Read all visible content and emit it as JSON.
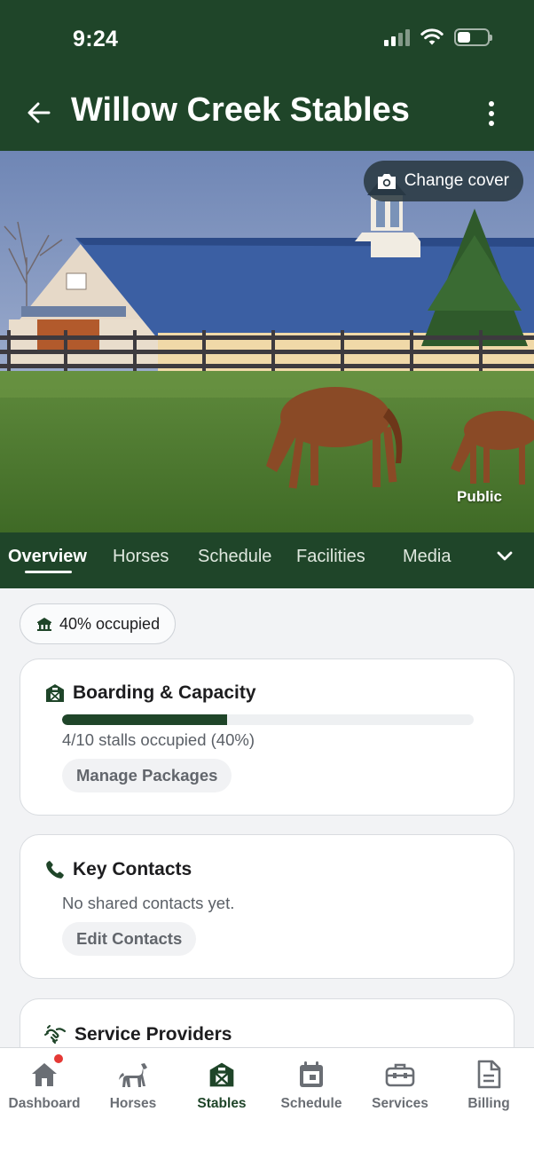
{
  "status_bar": {
    "time": "9:24"
  },
  "header": {
    "title": "Willow Creek Stables"
  },
  "cover": {
    "change_cover_label": "Change cover",
    "visibility_label": "Public"
  },
  "tabs": [
    {
      "label": "Overview",
      "active": true
    },
    {
      "label": "Horses"
    },
    {
      "label": "Schedule"
    },
    {
      "label": "Facilities"
    },
    {
      "label": "Media"
    }
  ],
  "occupancy_pill": {
    "label": "40% occupied"
  },
  "boarding": {
    "title": "Boarding & Capacity",
    "progress_fraction": 0.4,
    "summary": "4/10 stalls occupied (40%)",
    "button": "Manage Packages"
  },
  "contacts": {
    "title": "Key Contacts",
    "empty_text": "No shared contacts yet.",
    "button": "Edit Contacts"
  },
  "providers": {
    "title": "Service Providers"
  },
  "bottom_nav": [
    {
      "label": "Dashboard",
      "icon": "home-icon",
      "has_badge": true
    },
    {
      "label": "Horses",
      "icon": "horse-icon"
    },
    {
      "label": "Stables",
      "icon": "barn-icon",
      "active": true
    },
    {
      "label": "Schedule",
      "icon": "calendar-icon"
    },
    {
      "label": "Services",
      "icon": "toolbox-icon"
    },
    {
      "label": "Billing",
      "icon": "document-icon"
    }
  ],
  "colors": {
    "brand": "#1f4529",
    "badge": "#e53935",
    "background": "#f2f3f5"
  }
}
